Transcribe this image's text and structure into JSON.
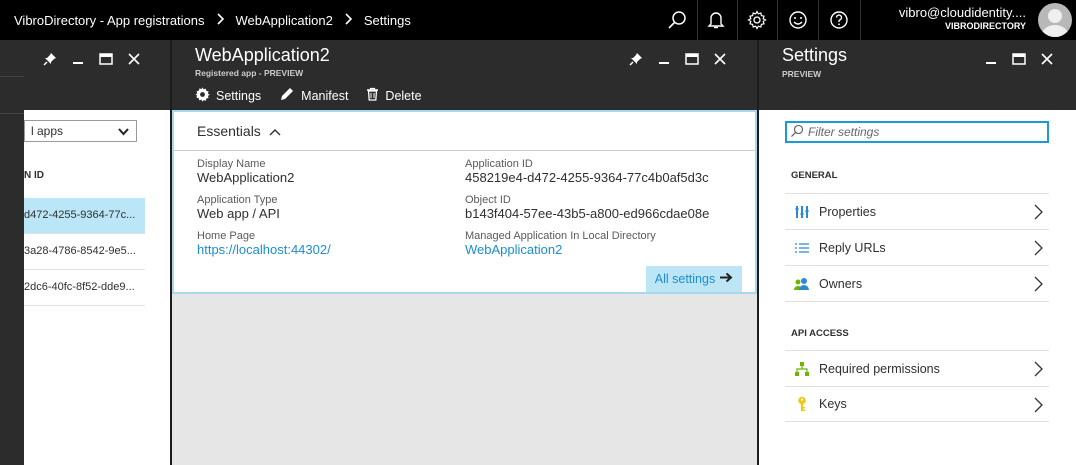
{
  "topbar": {
    "breadcrumbs": [
      "VibroDirectory - App registrations",
      "WebApplication2",
      "Settings"
    ],
    "icons": [
      "search-icon",
      "bell-icon",
      "gear-icon",
      "smiley-icon",
      "help-icon"
    ],
    "user_email": "vibro@cloudidentity....",
    "user_directory": "VIBRODIRECTORY"
  },
  "list_blade": {
    "filter_value": "l apps",
    "column_header": "N ID",
    "rows": [
      "d472-4255-9364-77c...",
      "3a28-4786-8542-9e5...",
      "2dc6-40fc-8f52-dde9..."
    ],
    "selected_row": 0
  },
  "app_blade": {
    "title": "WebApplication2",
    "subtitle": "Registered app - PREVIEW",
    "commands": [
      "Settings",
      "Manifest",
      "Delete"
    ],
    "essentials_label": "Essentials",
    "fields": {
      "display_name_label": "Display Name",
      "display_name": "WebApplication2",
      "app_type_label": "Application Type",
      "app_type": "Web app / API",
      "home_page_label": "Home Page",
      "home_page": "https://localhost:44302/",
      "app_id_label": "Application ID",
      "app_id": "458219e4-d472-4255-9364-77c4b0af5d3c",
      "object_id_label": "Object ID",
      "object_id": "b143f404-57ee-43b5-a800-ed966cdae08e",
      "managed_label": "Managed Application In Local Directory",
      "managed": "WebApplication2"
    },
    "all_settings": "All settings"
  },
  "settings_blade": {
    "title": "Settings",
    "subtitle": "PREVIEW",
    "filter_placeholder": "Filter settings",
    "general_label": "GENERAL",
    "general_items": [
      "Properties",
      "Reply URLs",
      "Owners"
    ],
    "api_label": "API ACCESS",
    "api_items": [
      "Required permissions",
      "Keys"
    ]
  },
  "colors": {
    "accent": "#1b8dd3",
    "selection": "#bbe6f7",
    "chrome": "#2c2c2c"
  }
}
